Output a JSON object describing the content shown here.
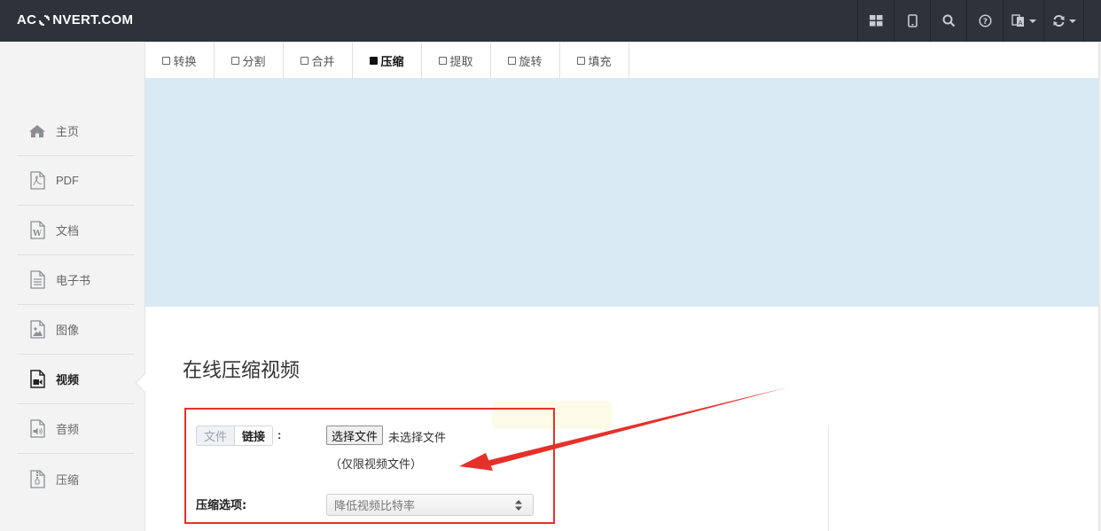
{
  "navbar": {
    "brand": "AC",
    "brand_rest": "NVERT.COM",
    "icons": [
      "grid-icon",
      "tablet-icon",
      "search-icon",
      "help-icon",
      "translate-icon",
      "refresh-icon"
    ]
  },
  "tabs": [
    {
      "label": "转换",
      "active": false
    },
    {
      "label": "分割",
      "active": false
    },
    {
      "label": "合并",
      "active": false
    },
    {
      "label": "压缩",
      "active": true
    },
    {
      "label": "提取",
      "active": false
    },
    {
      "label": "旋转",
      "active": false
    },
    {
      "label": "填充",
      "active": false
    }
  ],
  "sidebar": {
    "items": [
      {
        "label": "主页",
        "icon": "home-icon"
      },
      {
        "label": "PDF",
        "icon": "pdf-file-icon"
      },
      {
        "label": "文档",
        "icon": "word-file-icon"
      },
      {
        "label": "电子书",
        "icon": "ebook-file-icon"
      },
      {
        "label": "图像",
        "icon": "image-file-icon"
      },
      {
        "label": "视频",
        "icon": "video-file-icon",
        "active": true
      },
      {
        "label": "音频",
        "icon": "audio-file-icon"
      },
      {
        "label": "压缩",
        "icon": "archive-file-icon"
      }
    ]
  },
  "main": {
    "title": "在线压缩视频",
    "source_tabs": [
      "文件",
      "链接"
    ],
    "colon": ":",
    "file_button": "选择文件",
    "no_file": "未选择文件",
    "hint": "（仅限视频文件）",
    "option_label": "压缩选项:",
    "option_value": "降低视频比特率"
  },
  "colors": {
    "navbar": "#2e323a",
    "banner": "#d9eaf4",
    "annotation": "#e5312a"
  }
}
